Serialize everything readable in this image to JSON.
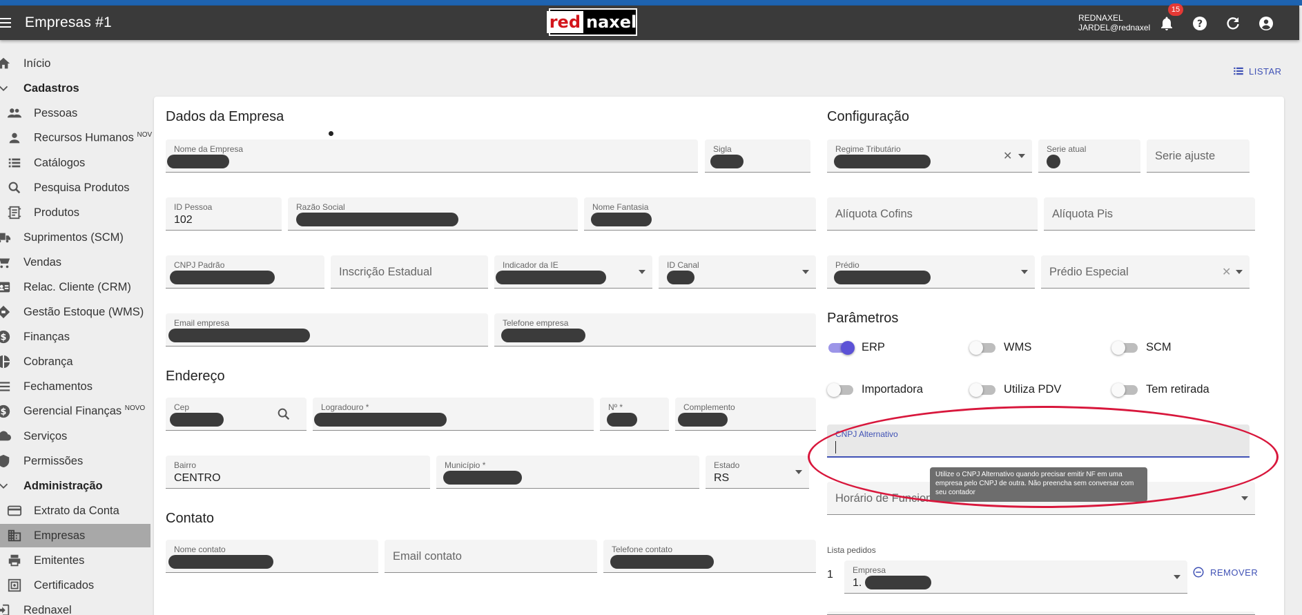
{
  "appbar": {
    "title": "Empresas #1",
    "logo_red": "red",
    "logo_rest": "naxel",
    "user_line1": "REDNAXEL",
    "user_line2": "JARDEL@rednaxel",
    "notifications": "15"
  },
  "sidebar": {
    "items": [
      {
        "label": "Início",
        "icon": "home-icon"
      },
      {
        "label": "Cadastros",
        "icon": "chevron-down-icon"
      },
      {
        "label": "Pessoas",
        "icon": "people-icon"
      },
      {
        "label": "Recursos Humanos",
        "sup": "NOV",
        "icon": "person-icon"
      },
      {
        "label": "Catálogos",
        "icon": "list-icon"
      },
      {
        "label": "Pesquisa Produtos",
        "icon": "search-icon"
      },
      {
        "label": "Produtos",
        "icon": "product-icon"
      },
      {
        "label": "Suprimentos (SCM)",
        "icon": "truck-icon"
      },
      {
        "label": "Vendas",
        "icon": "cart-icon"
      },
      {
        "label": "Relac. Cliente (CRM)",
        "icon": "contact-card-icon"
      },
      {
        "label": "Gestão Estoque (WMS)",
        "icon": "diamond-icon"
      },
      {
        "label": "Finanças",
        "icon": "dollar-icon"
      },
      {
        "label": "Cobrança",
        "icon": "pie-icon"
      },
      {
        "label": "Fechamentos",
        "icon": "lines-icon"
      },
      {
        "label": "Gerencial Finanças",
        "sup": "NOVO",
        "icon": "dollar-icon"
      },
      {
        "label": "Serviços",
        "icon": "cloud-icon"
      },
      {
        "label": "Permissões",
        "icon": "shield-icon"
      },
      {
        "label": "Administração",
        "icon": "chevron-down-icon"
      },
      {
        "label": "Extrato da Conta",
        "icon": "card-icon"
      },
      {
        "label": "Empresas",
        "icon": "building-icon"
      },
      {
        "label": "Emitentes",
        "icon": "printer-icon"
      },
      {
        "label": "Certificados",
        "icon": "certificate-icon"
      },
      {
        "label": "Rednaxel",
        "icon": "exit-icon"
      }
    ]
  },
  "listar_label": "LISTAR",
  "dados": {
    "heading": "Dados da Empresa",
    "nome_empresa": "Nome da Empresa",
    "sigla": "Sigla",
    "id_pessoa_label": "ID Pessoa",
    "id_pessoa_value": "102",
    "razao_social": "Razão Social",
    "nome_fantasia": "Nome Fantasia",
    "cnpj_padrao": "CNPJ Padrão",
    "inscricao_estadual": "Inscrição Estadual",
    "indicador_ie": "Indicador da IE",
    "id_canal": "ID Canal",
    "email_empresa": "Email empresa",
    "telefone_empresa": "Telefone empresa"
  },
  "endereco": {
    "heading": "Endereço",
    "cep": "Cep",
    "logradouro": "Logradouro *",
    "numero": "Nº *",
    "complemento": "Complemento",
    "bairro_label": "Bairro",
    "bairro_value": "CENTRO",
    "municipio": "Município *",
    "estado_label": "Estado",
    "estado_value": "RS"
  },
  "contato": {
    "heading": "Contato",
    "nome_contato": "Nome contato",
    "email_contato": "Email contato",
    "telefone_contato": "Telefone contato"
  },
  "config": {
    "heading": "Configuração",
    "regime": "Regime Tributário",
    "serie_atual": "Serie atual",
    "serie_ajuste": "Serie ajuste",
    "aliquota_cofins": "Alíquota Cofins",
    "aliquota_pis": "Alíquota Pis",
    "predio": "Prédio",
    "predio_especial": "Prédio Especial"
  },
  "parametros": {
    "heading": "Parâmetros",
    "toggles": [
      {
        "label": "ERP",
        "on": true
      },
      {
        "label": "WMS",
        "on": false
      },
      {
        "label": "SCM",
        "on": false
      },
      {
        "label": "Importadora",
        "on": false
      },
      {
        "label": "Utiliza PDV",
        "on": false
      },
      {
        "label": "Tem retirada",
        "on": false
      }
    ],
    "cnpj_alternativo": "CNPJ Alternativo",
    "tooltip": "Utilize o CNPJ Alternativo quando precisar emitir NF em uma empresa pelo CNPJ de outra. Não preencha sem conversar com seu contador",
    "horario": "Horário de Funcionamento"
  },
  "lista_pedidos": {
    "label": "Lista pedidos",
    "num": "1",
    "empresa_label": "Empresa",
    "empresa_prefix": "1.",
    "remover": "REMOVER"
  },
  "colors": {
    "primary": "#3f51b5",
    "appbar": "#3a3a3a",
    "highlight_circle": "#d8173c",
    "toggle_on": "#5c52d6"
  }
}
